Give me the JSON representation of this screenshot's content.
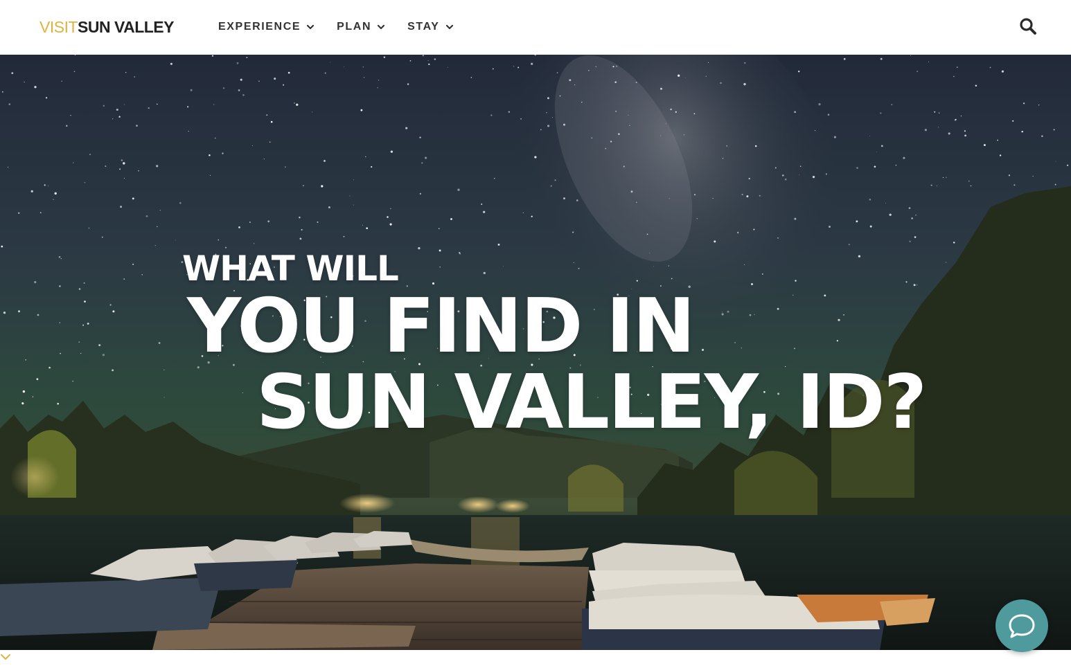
{
  "header": {
    "logo_visit": "VISIT",
    "logo_name": "SUN VALLEY",
    "nav": [
      {
        "label": "EXPERIENCE"
      },
      {
        "label": "PLAN"
      },
      {
        "label": "STAY"
      }
    ],
    "search_icon": "search-icon"
  },
  "hero": {
    "line1": "WHAT WILL",
    "line2": "YOU FIND IN",
    "line3": "SUN VALLEY, ID?"
  },
  "chat": {
    "icon": "chat-bubble-icon",
    "color": "#4f9a9c"
  },
  "colors": {
    "logo_accent": "#e0b340",
    "nav_text": "#333333"
  }
}
